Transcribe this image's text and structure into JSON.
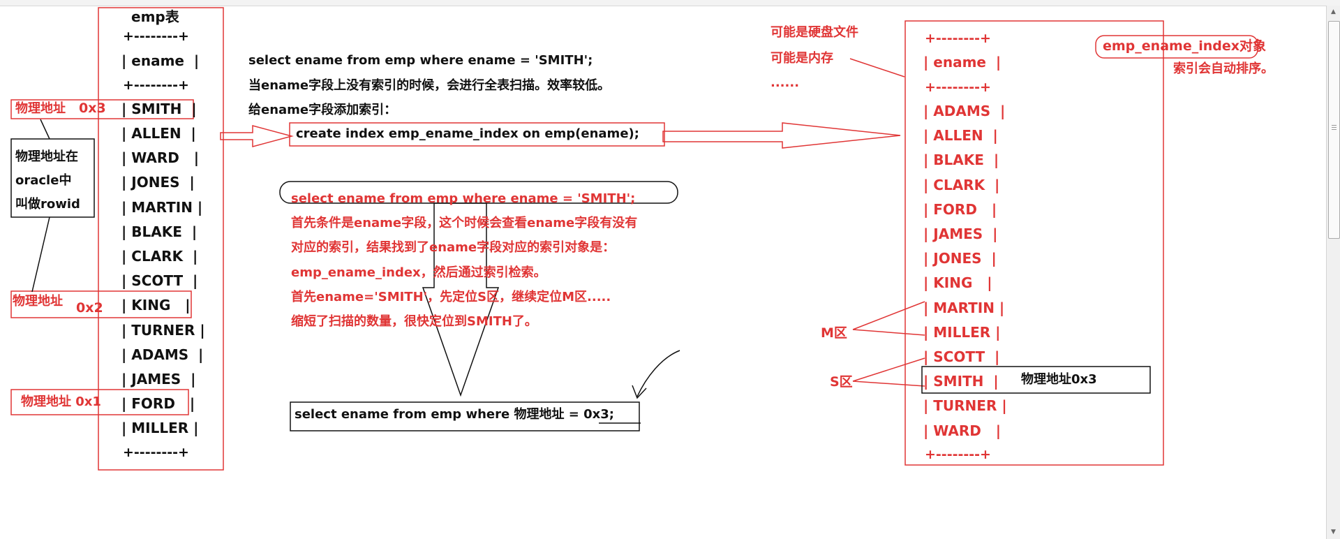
{
  "emp_table": {
    "title": "emp表",
    "border": "+--------+",
    "header": "| ename  |",
    "rows": [
      "| SMITH  |",
      "| ALLEN  |",
      "| WARD   |",
      "| JONES  |",
      "| MARTIN |",
      "| BLAKE  |",
      "| CLARK  |",
      "| SCOTT  |",
      "| KING   |",
      "| TURNER |",
      "| ADAMS  |",
      "| JAMES  |",
      "| FORD   |",
      "| MILLER |"
    ]
  },
  "left_notes": {
    "addr_smith": "物理地址",
    "addr_smith_value": "0x3",
    "addr_king": "物理地址",
    "addr_king_value": "0x2",
    "addr_ford": "物理地址 0x1",
    "rowid_note": [
      "物理地址在",
      "oracle中",
      "叫做rowid"
    ]
  },
  "explanation": {
    "lines": [
      "select ename from emp where ename = 'SMITH';",
      "当ename字段上没有索引的时候，会进行全表扫描。效率较低。",
      "给ename字段添加索引："
    ],
    "create_index": "create index emp_ename_index on emp(ename);"
  },
  "lookup": {
    "lines": [
      "select ename from emp where ename = 'SMITH';",
      "首先条件是ename字段，这个时候会查看ename字段有没有",
      "对应的索引，结果找到了ename字段对应的索引对象是：",
      "emp_ename_index，然后通过索引检索。",
      "首先ename='SMITH'，先定位S区，继续定位M区.....",
      "缩短了扫描的数量，很快定位到SMITH了。"
    ],
    "final_query": "select ename from emp where 物理地址 = 0x3;"
  },
  "storage_note": [
    "可能是硬盘文件",
    "可能是内存",
    "......"
  ],
  "index": {
    "name": "emp_ename_index对象",
    "sorted_note": "索引会自动排序。",
    "border": "+--------+",
    "header": "| ename  |",
    "rows": [
      "| ADAMS  |",
      "| ALLEN  |",
      "| BLAKE  |",
      "| CLARK  |",
      "| FORD   |",
      "| JAMES  |",
      "| JONES  |",
      "| KING   |",
      "| MARTIN |",
      "| MILLER |",
      "| SCOTT  |",
      "| SMITH  |",
      "| TURNER |",
      "| WARD   |"
    ],
    "m_zone": "M区",
    "s_zone": "S区",
    "smith_addr": "物理地址0x3"
  },
  "colors": {
    "red": "#e03535",
    "black": "#111111",
    "background": "#ffffff"
  }
}
